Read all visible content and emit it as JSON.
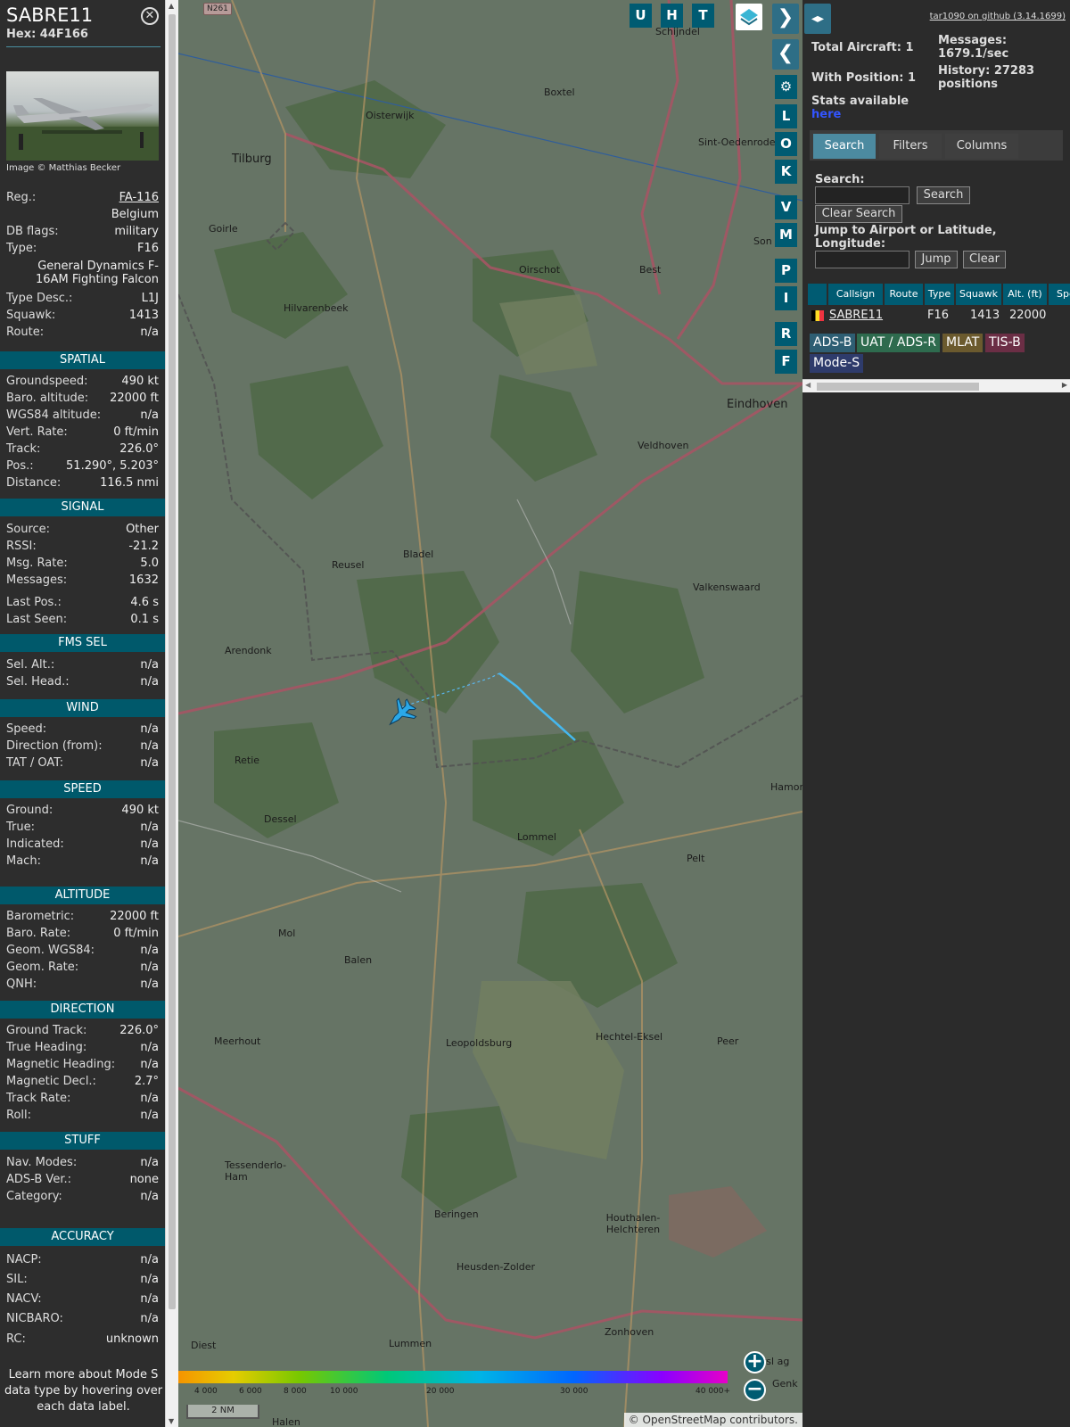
{
  "selected": {
    "callsign": "SABRE11",
    "hex": "Hex: 44F166",
    "close_icon": "close-icon",
    "photo_credit": "Image © Matthias Becker",
    "info_rows": [
      {
        "k": "Reg.:",
        "v": "FA-116"
      },
      {
        "k": "",
        "v": "Belgium"
      },
      {
        "k": "DB flags:",
        "v": "military"
      },
      {
        "k": "Type:",
        "v": "F16"
      }
    ],
    "type_full": "General Dynamics F-16AM Fighting Falcon",
    "info_rows2": [
      {
        "k": "Type Desc.:",
        "v": "L1J"
      },
      {
        "k": "Squawk:",
        "v": "1413"
      },
      {
        "k": "Route:",
        "v": "n/a"
      }
    ],
    "sections": [
      {
        "title": "SPATIAL",
        "rows": [
          {
            "k": "Groundspeed:",
            "v": "490 kt"
          },
          {
            "k": "Baro. altitude:",
            "v": "22000 ft"
          },
          {
            "k": "WGS84 altitude:",
            "v": "n/a"
          },
          {
            "k": "Vert. Rate:",
            "v": "0 ft/min"
          },
          {
            "k": "Track:",
            "v": "226.0°"
          },
          {
            "k": "Pos.:",
            "v": "51.290°, 5.203°"
          },
          {
            "k": "Distance:",
            "v": "116.5 nmi"
          }
        ]
      },
      {
        "title": "SIGNAL",
        "rows": [
          {
            "k": "Source:",
            "v": "Other"
          },
          {
            "k": "RSSI:",
            "v": "-21.2"
          },
          {
            "k": "Msg. Rate:",
            "v": "5.0"
          },
          {
            "k": "Messages:",
            "v": "1632"
          },
          {
            "k": "Last Pos.:",
            "v": "4.6 s"
          },
          {
            "k": "Last Seen:",
            "v": "0.1 s"
          }
        ]
      },
      {
        "title": "FMS SEL",
        "rows": [
          {
            "k": "Sel. Alt.:",
            "v": "n/a"
          },
          {
            "k": "Sel. Head.:",
            "v": "n/a"
          }
        ]
      },
      {
        "title": "WIND",
        "rows": [
          {
            "k": "Speed:",
            "v": "n/a"
          },
          {
            "k": "Direction (from):",
            "v": "n/a"
          },
          {
            "k": "TAT / OAT:",
            "v": "n/a"
          }
        ]
      },
      {
        "title": "SPEED",
        "rows": [
          {
            "k": "Ground:",
            "v": "490 kt"
          },
          {
            "k": "True:",
            "v": "n/a"
          },
          {
            "k": "Indicated:",
            "v": "n/a"
          },
          {
            "k": "Mach:",
            "v": "n/a"
          }
        ]
      },
      {
        "title": "ALTITUDE",
        "rows": [
          {
            "k": "Barometric:",
            "v": "22000 ft"
          },
          {
            "k": "Baro. Rate:",
            "v": "0 ft/min"
          },
          {
            "k": "Geom. WGS84:",
            "v": "n/a"
          },
          {
            "k": "Geom. Rate:",
            "v": "n/a"
          },
          {
            "k": "QNH:",
            "v": "n/a"
          }
        ]
      },
      {
        "title": "DIRECTION",
        "rows": [
          {
            "k": "Ground Track:",
            "v": "226.0°"
          },
          {
            "k": "True Heading:",
            "v": "n/a"
          },
          {
            "k": "Magnetic Heading:",
            "v": "n/a"
          },
          {
            "k": "Magnetic Decl.:",
            "v": "2.7°"
          },
          {
            "k": "Track Rate:",
            "v": "n/a"
          },
          {
            "k": "Roll:",
            "v": "n/a"
          }
        ]
      },
      {
        "title": "STUFF",
        "rows": [
          {
            "k": "Nav. Modes:",
            "v": "n/a"
          },
          {
            "k": "ADS-B Ver.:",
            "v": "none"
          },
          {
            "k": "Category:",
            "v": "n/a"
          }
        ]
      },
      {
        "title": "ACCURACY",
        "rows": [
          {
            "k": "NACP:",
            "v": "n/a"
          },
          {
            "k": "SIL:",
            "v": "n/a"
          },
          {
            "k": "NACV:",
            "v": "n/a"
          },
          {
            "k": "NICBARO:",
            "v": "n/a"
          },
          {
            "k": "RC:",
            "v": "unknown"
          }
        ]
      }
    ],
    "learn_more": "Learn more about Mode S data type by hovering over each data label."
  },
  "map": {
    "top_buttons": [
      "U",
      "H",
      "T"
    ],
    "side_buttons": [
      "L",
      "O",
      "K",
      "V",
      "M",
      "P",
      "I",
      "R",
      "F"
    ],
    "town_labels": [
      {
        "t": "N261",
        "road": true
      },
      {
        "t": "Schijndel"
      },
      {
        "t": "Boxtel"
      },
      {
        "t": "Oisterwijk"
      },
      {
        "t": "Sint-Oedenrode"
      },
      {
        "t": "Tilburg"
      },
      {
        "t": "Goirle"
      },
      {
        "t": "Oirschot"
      },
      {
        "t": "Best"
      },
      {
        "t": "Son e"
      },
      {
        "t": "Hilvarenbeek"
      },
      {
        "t": "Eindhoven"
      },
      {
        "t": "Veldhoven"
      },
      {
        "t": "Bladel"
      },
      {
        "t": "Reusel"
      },
      {
        "t": "Valkenswaard"
      },
      {
        "t": "Arendonk"
      },
      {
        "t": "Retie"
      },
      {
        "t": "Dessel"
      },
      {
        "t": "Lommel"
      },
      {
        "t": "Pelt"
      },
      {
        "t": "Mol"
      },
      {
        "t": "Balen"
      },
      {
        "t": "Meerhout"
      },
      {
        "t": "Leopoldsburg"
      },
      {
        "t": "Hechtel-Eksel"
      },
      {
        "t": "Peer"
      },
      {
        "t": "Tessenderlo-Ham"
      },
      {
        "t": "Beringen"
      },
      {
        "t": "Houthalen-Helchteren"
      },
      {
        "t": "Heusden-Zolder"
      },
      {
        "t": "Zonhoven"
      },
      {
        "t": "Lummen"
      },
      {
        "t": "Diest"
      },
      {
        "t": "Halen"
      },
      {
        "t": "Hamon"
      },
      {
        "t": "Genk"
      },
      {
        "t": "ersl ag"
      }
    ],
    "legend_ticks": [
      "4 000",
      "6 000",
      "8 000",
      "10 000",
      "20 000",
      "30 000",
      "40 000+"
    ],
    "scale": "2 NM",
    "attribution": "© OpenStreetMap contributors."
  },
  "panel": {
    "github": "tar1090 on github (3.14.1699)",
    "total_aircraft": "Total Aircraft: 1",
    "with_position": "With Position: 1",
    "stats": "Stats available",
    "stats_link": "here",
    "messages": "Messages: 1679.1/sec",
    "history": "History: 27283 positions",
    "tabs": [
      "Search",
      "Filters",
      "Columns"
    ],
    "search_label": "Search:",
    "search_btn": "Search",
    "clear_search": "Clear Search",
    "jump_label": "Jump to Airport or Latitude, Longitude:",
    "jump_btn": "Jump",
    "clear_btn": "Clear",
    "table_headers": [
      "Callsign",
      "Route",
      "Type",
      "Squawk",
      "Alt. (ft)",
      "Spd"
    ],
    "table_row": {
      "callsign": "SABRE11",
      "route": "",
      "type": "F16",
      "squawk": "1413",
      "alt": "22000"
    },
    "badges": [
      "ADS-B",
      "UAT / ADS-R",
      "MLAT",
      "TIS-B",
      "Mode-S"
    ]
  }
}
